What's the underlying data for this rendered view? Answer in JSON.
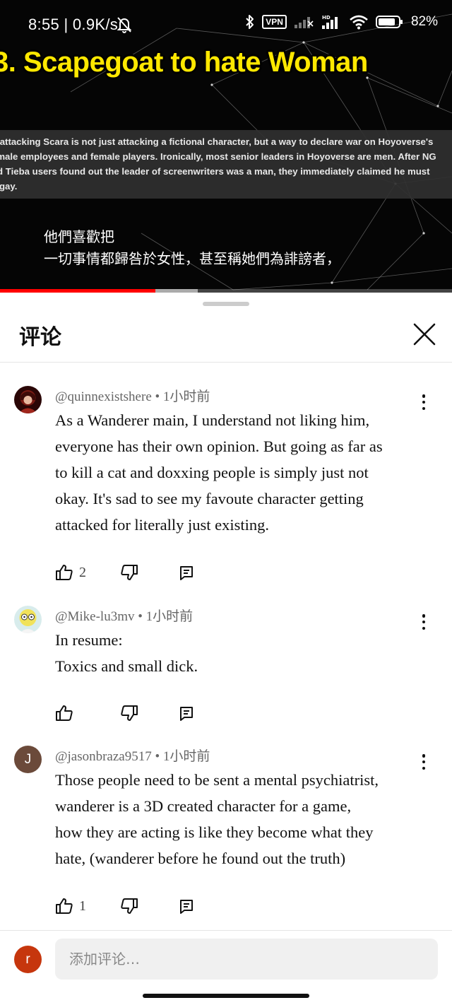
{
  "status_bar": {
    "time": "8:55",
    "speed": "0.9K/s",
    "vpn_label": "VPN",
    "battery": "82%",
    "icons": [
      "bell-off-icon",
      "bluetooth-icon",
      "vpn-icon",
      "signal-icon",
      "hd-signal-icon",
      "wifi-icon",
      "battery-icon"
    ]
  },
  "video": {
    "title": "3. Scapegoat to hate Woman",
    "caption_lines": [
      "o attacking Scara is not just attacking a fictional character, but a way to declare war on Hoyoverse's",
      "emale employees and female players. Ironically, most senior leaders in Hoyoverse are men. After NG",
      "nd Tieba users found out the leader of screenwriters was a man, they immediately claimed he must",
      "e gay."
    ],
    "subtitle_lines": [
      "他們喜歡把",
      "一切事情都歸咎於女性，甚至稱她們為誹謗者，"
    ],
    "progress_played": 0.344,
    "progress_buffered": 0.438,
    "colors": {
      "title": "#ffe800",
      "progress": "#ff0000"
    }
  },
  "sheet": {
    "title": "评论",
    "close_icon": "close-icon"
  },
  "comments": [
    {
      "author": "@quinnexistshere",
      "time": "1小时前",
      "text": "As a Wanderer main, I understand not liking him,\neveryone has their own opinion. But going as far as\nto kill a cat and doxxing people is simply just not\nokay. It's sad to see my favoute character getting\nattacked for literally just existing.",
      "likes": "2",
      "avatar": "anime-avatar-red"
    },
    {
      "author": "@Mike-lu3mv",
      "time": "1小时前",
      "text": "In resume:\nToxics and small dick.",
      "likes": "",
      "avatar": "cartoon-avatar-yellow"
    },
    {
      "author": "@jasonbraza9517",
      "time": "1小时前",
      "text": "Those people need to be sent a mental psychiatrist,\nwanderer is a 3D created character for a game,\nhow they are acting is like they become what they\nhate, (wanderer before he found out the truth)",
      "likes": "1",
      "avatar_letter": "J",
      "avatar_color": "#6b4a3a"
    }
  ],
  "compose": {
    "avatar_letter": "r",
    "avatar_color": "#c6360d",
    "placeholder": "添加评论…"
  }
}
